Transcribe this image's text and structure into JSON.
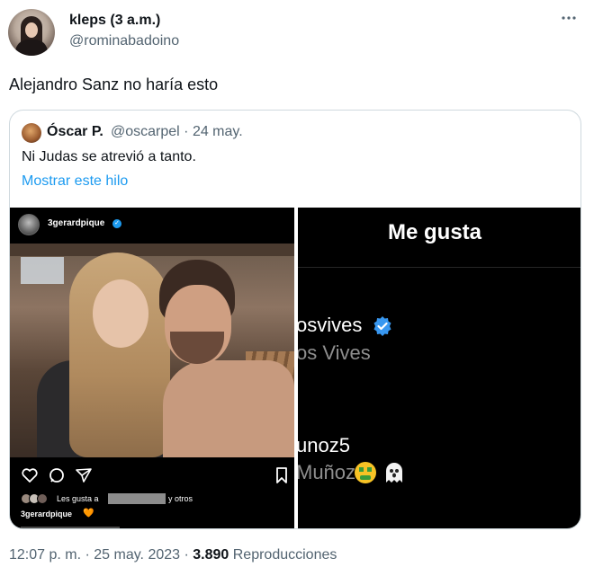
{
  "author": {
    "display_name": "kleps (3 a.m.)",
    "handle": "@rominabadoino",
    "more_icon": "more-horizontal-icon"
  },
  "tweet": {
    "text": "Alejandro Sanz no haría esto"
  },
  "quote": {
    "display_name": "Óscar P.",
    "meta": "@oscarpel · 24 may.",
    "text": "Ni Judas se atrevió a tanto.",
    "show_thread": "Mostrar este hilo"
  },
  "instagram_post": {
    "username": "3gerardpique",
    "likes_prefix": "Les gusta a",
    "likes_suffix": "y otros",
    "caption_user": "3gerardpique",
    "caption_emoji": "🧡",
    "icons": [
      "heart-icon",
      "comment-icon",
      "share-icon",
      "bookmark-icon"
    ]
  },
  "likes_panel": {
    "title": "Me gusta",
    "user1_handle": "osvives",
    "user1_name": "os Vives",
    "user2_handle": "unoz5",
    "user2_name": "Muñoz"
  },
  "footer": {
    "time": "12:07 p. m. · 25 may. 2023 · ",
    "views": "3.890",
    "views_label": " Reproducciones"
  },
  "colors": {
    "link": "#1d9bf0",
    "secondary_text": "#536471",
    "primary_text": "#0f1419",
    "border": "#cfd9de"
  }
}
